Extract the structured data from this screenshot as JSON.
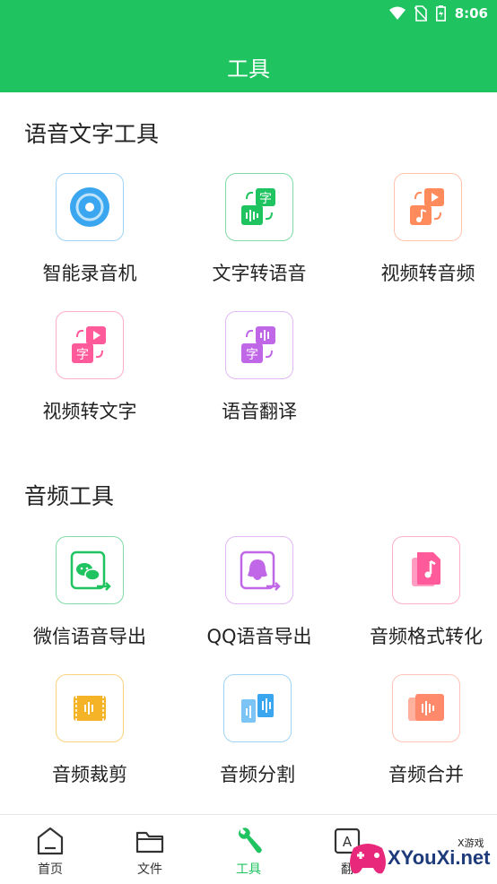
{
  "status_bar": {
    "time": "8:06",
    "icons": [
      "wifi-icon",
      "no-sim-icon",
      "battery-icon"
    ]
  },
  "header": {
    "title": "工具"
  },
  "sections": [
    {
      "title": "语音文字工具",
      "tools": [
        {
          "label": "智能录音机",
          "icon": "recorder-icon",
          "color": "#3aa6f0"
        },
        {
          "label": "文字转语音",
          "icon": "text-to-speech-icon",
          "color": "#1fc35f"
        },
        {
          "label": "视频转音频",
          "icon": "video-to-audio-icon",
          "color": "#ff8a5b"
        },
        {
          "label": "视频转文字",
          "icon": "video-to-text-icon",
          "color": "#ff5a9a"
        },
        {
          "label": "语音翻译",
          "icon": "voice-translate-icon",
          "color": "#c067e8"
        }
      ]
    },
    {
      "title": "音频工具",
      "tools": [
        {
          "label": "微信语音导出",
          "icon": "wechat-export-icon",
          "color": "#1fc35f"
        },
        {
          "label": "QQ语音导出",
          "icon": "qq-export-icon",
          "color": "#c067e8"
        },
        {
          "label": "音频格式转化",
          "icon": "audio-format-icon",
          "color": "#ff5a9a"
        },
        {
          "label": "音频裁剪",
          "icon": "audio-trim-icon",
          "color": "#f5b327"
        },
        {
          "label": "音频分割",
          "icon": "audio-split-icon",
          "color": "#3aa6f0"
        },
        {
          "label": "音频合并",
          "icon": "audio-merge-icon",
          "color": "#ff8a6b"
        }
      ]
    }
  ],
  "tabbar": {
    "active_color": "#1fc35f",
    "tabs": [
      {
        "label": "首页",
        "icon": "home-icon",
        "active": false
      },
      {
        "label": "文件",
        "icon": "folder-icon",
        "active": false
      },
      {
        "label": "工具",
        "icon": "wrench-icon",
        "active": true
      },
      {
        "label": "翻",
        "icon": "translate-icon",
        "active": false
      }
    ]
  },
  "watermark": {
    "text": "XYouXi.net",
    "small": "X游戏"
  }
}
